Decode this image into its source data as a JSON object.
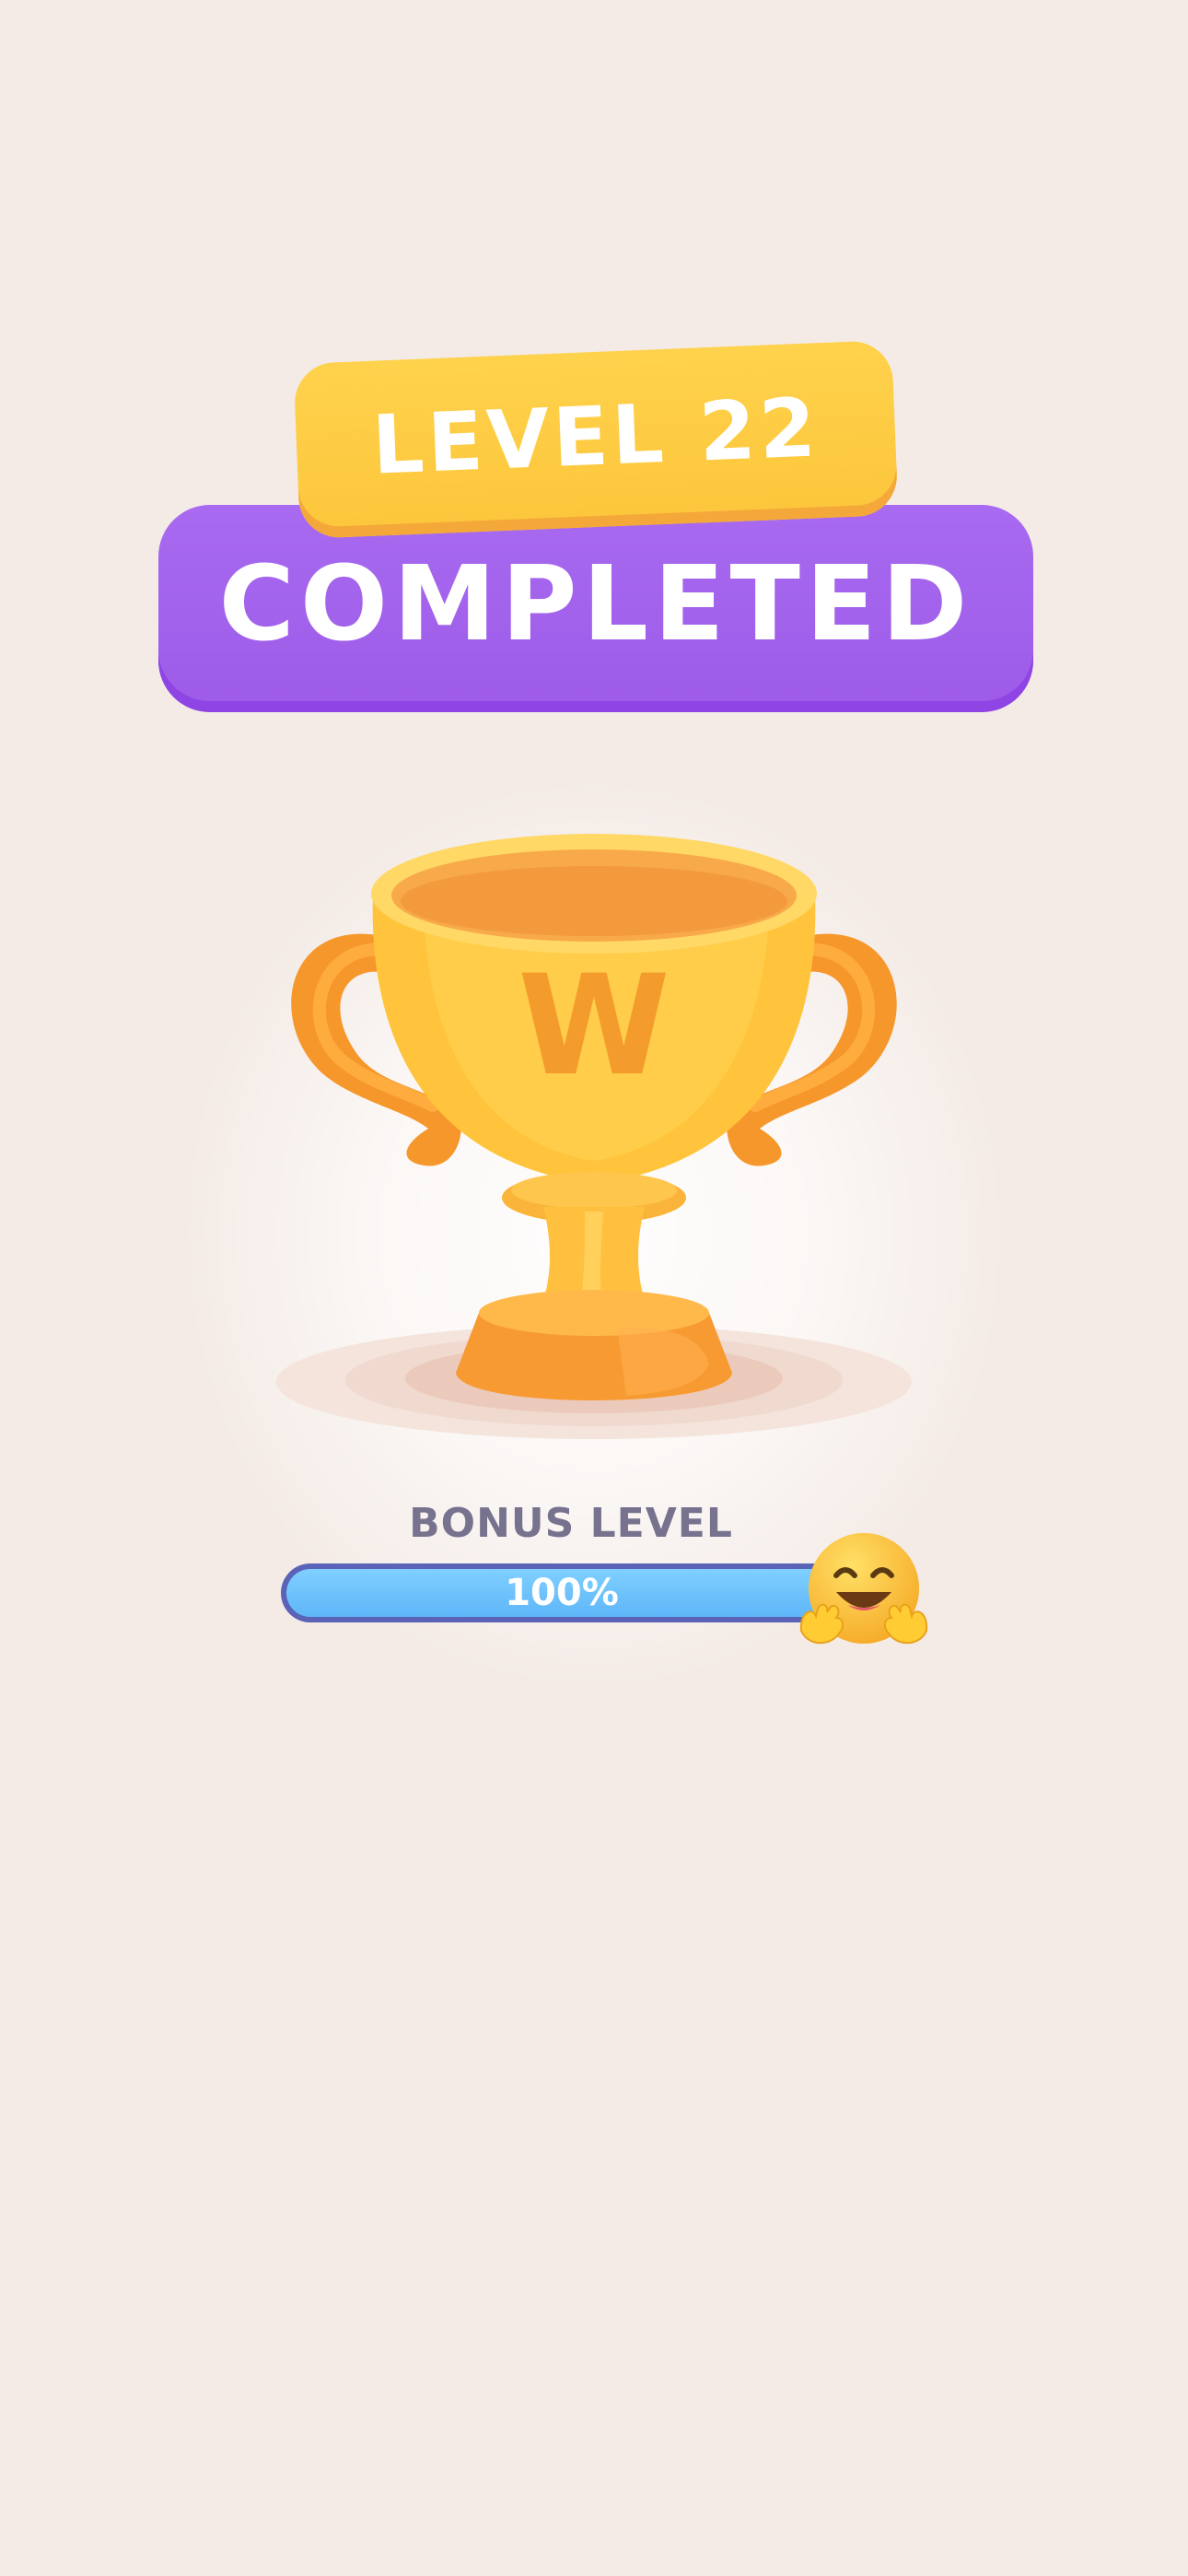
{
  "header": {
    "level_label": "LEVEL 22",
    "status_label": "COMPLETED"
  },
  "trophy": {
    "letter": "W"
  },
  "bonus": {
    "label": "BONUS LEVEL",
    "progress_text": "100%",
    "progress_value": 1.0,
    "emoji": "hugging-face-icon"
  },
  "colors": {
    "background": "#f4ebe6",
    "level_badge": "#fcc63a",
    "completed_banner": "#a067ee",
    "trophy_gold": "#ffc93f",
    "progress_fill": "#6ec4fc",
    "progress_border": "#5a63b8",
    "bonus_label": "#77738e"
  }
}
